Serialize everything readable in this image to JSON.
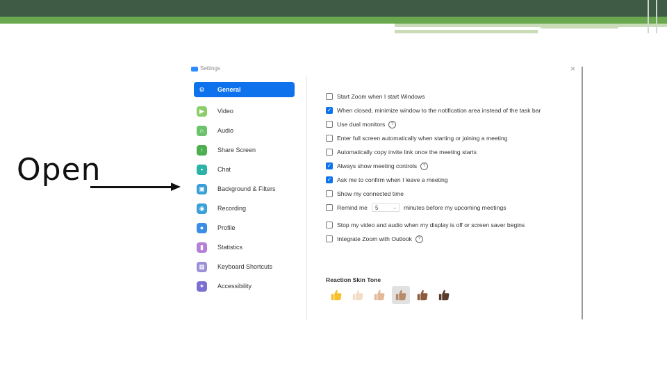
{
  "annotation": {
    "text": "Open"
  },
  "window": {
    "title": "Settings",
    "close_glyph": "×"
  },
  "sidebar": {
    "items": [
      {
        "label": "General",
        "icon": "gear-icon",
        "icon_glyph": "⚙",
        "color": "#0e72ed",
        "active": true
      },
      {
        "label": "Video",
        "icon": "video-icon",
        "icon_glyph": "▶",
        "color": "#8ccf6a"
      },
      {
        "label": "Audio",
        "icon": "headphones-icon",
        "icon_glyph": "∩",
        "color": "#6ac26a"
      },
      {
        "label": "Share Screen",
        "icon": "share-screen-icon",
        "icon_glyph": "↑",
        "color": "#4caf50"
      },
      {
        "label": "Chat",
        "icon": "chat-icon",
        "icon_glyph": "▪",
        "color": "#2bb3a6"
      },
      {
        "label": "Background & Filters",
        "icon": "background-icon",
        "icon_glyph": "▣",
        "color": "#3aa0d8"
      },
      {
        "label": "Recording",
        "icon": "recording-icon",
        "icon_glyph": "◉",
        "color": "#3aa0d8"
      },
      {
        "label": "Profile",
        "icon": "profile-icon",
        "icon_glyph": "●",
        "color": "#3a8ee6"
      },
      {
        "label": "Statistics",
        "icon": "statistics-icon",
        "icon_glyph": "▮",
        "color": "#b57fd6"
      },
      {
        "label": "Keyboard Shortcuts",
        "icon": "keyboard-icon",
        "icon_glyph": "▦",
        "color": "#9c8fd8"
      },
      {
        "label": "Accessibility",
        "icon": "accessibility-icon",
        "icon_glyph": "✦",
        "color": "#7b6fd1"
      }
    ]
  },
  "options": [
    {
      "label": "Start Zoom when I start Windows",
      "checked": false
    },
    {
      "label": "When closed, minimize window to the notification area instead of the task bar",
      "checked": true
    },
    {
      "label": "Use dual monitors",
      "checked": false,
      "help": "?"
    },
    {
      "label": "Enter full screen automatically when starting or joining a meeting",
      "checked": false
    },
    {
      "label": "Automatically copy invite link once the meeting starts",
      "checked": false
    },
    {
      "label": "Always show meeting controls",
      "checked": true,
      "help": "?"
    },
    {
      "label": "Ask me to confirm when I leave a meeting",
      "checked": true
    },
    {
      "label": "Show my connected time",
      "checked": false
    }
  ],
  "remind": {
    "prefix": "Remind me",
    "value": "5",
    "suffix": "minutes before my upcoming meetings",
    "checked": false
  },
  "options_lower": [
    {
      "label": "Stop my video and audio when my display is off or screen saver begins",
      "checked": false
    },
    {
      "label": "Integrate Zoom with Outlook",
      "checked": false,
      "help": "?"
    }
  ],
  "reaction": {
    "title": "Reaction Skin Tone",
    "tones": [
      "#f6c02a",
      "#f3dcc8",
      "#e3b99a",
      "#b88a6c",
      "#8b5b3e",
      "#5a3c2a"
    ],
    "selected_index": 3
  }
}
